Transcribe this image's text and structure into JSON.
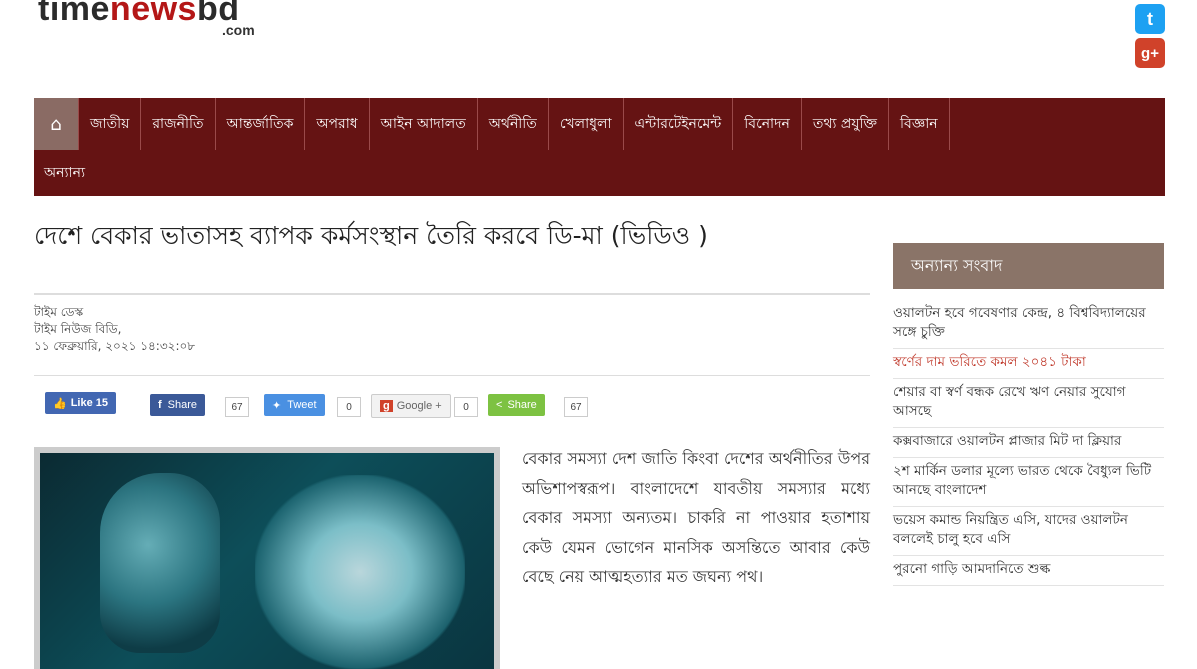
{
  "site": {
    "logo_part1": "time",
    "logo_part2": "news",
    "logo_part3": "bd",
    "logo_sub": ".com"
  },
  "social": {
    "twitter": "t",
    "googleplus": "g+"
  },
  "nav": {
    "items": [
      "জাতীয়",
      "রাজনীতি",
      "আন্তর্জাতিক",
      "অপরাধ",
      "আইন আদালত",
      "অর্থনীতি",
      "খেলাধুলা",
      "এন্টারটেইনমেন্ট",
      "বিনোদন",
      "তথ্য প্রযুক্তি",
      "বিজ্ঞান"
    ],
    "row2": "অন্যান্য"
  },
  "article": {
    "title": "দেশে বেকার ভাতাসহ ব্যাপক কর্মসংস্থান তৈরি করবে ডি-মা (ভিডিও )",
    "meta": [
      "টাইম ডেস্ক",
      "টাইম নিউজ বিডি,",
      "১১ ফেব্রুয়ারি, ২০২১ ১৪:৩২:০৮"
    ],
    "body": "বেকার সমস্যা দেশ জাতি কিংবা দেশের অর্থনীতির উপর অভিশাপস্বরূপ। বাংলাদেশে যাবতীয় সমস্যার মধ্যে বেকার সমস্যা অন্যতম। চাকরি না পাওয়ার হতাশায় কেউ যেমন ভোগেন মানসিক অসন্তিতে আবার কেউ বেছে নেয় আত্মহত্যার মত জঘন্য পথ।"
  },
  "share": {
    "like": "Like 15",
    "facebook": "Share",
    "facebook_count": "67",
    "tweet": "Tweet",
    "tweet_count": "0",
    "google": "Google +",
    "google_count": "0",
    "sharebtn": "Share",
    "share_count": "67"
  },
  "sidebar": {
    "heading": "অন্যান্য সংবাদ",
    "items": [
      "ওয়ালটন হবে গবেষণার কেন্দ্র, ৪ বিশ্ববিদ্যালয়ের সঙ্গে চুক্তি",
      "স্বর্ণের দাম ভরিতে কমল ২০৪১ টাকা",
      "শেয়ার বা স্বর্ণ বন্ধক রেখে ঋণ নেয়ার সুযোগ আসছে",
      "কক্সবাজারে ওয়ালটন প্লাজার মিট দা ক্লিয়ার",
      "২শ মার্কিন ডলার মূল্যে ভারত থেকে বৈধ্যুল ভিটি আনছে বাংলাদেশ",
      "ভয়েস কমান্ড নিয়ন্ত্রিত এসি, যাদের ওয়ালটন বললেই চালু হবে এসি",
      "পুরনো গাড়ি আমদানিতে শুল্ক"
    ]
  },
  "colors": {
    "nav_bg": "#651313",
    "accent_red": "#c0392b",
    "sidebar_head": "#8a7468"
  }
}
